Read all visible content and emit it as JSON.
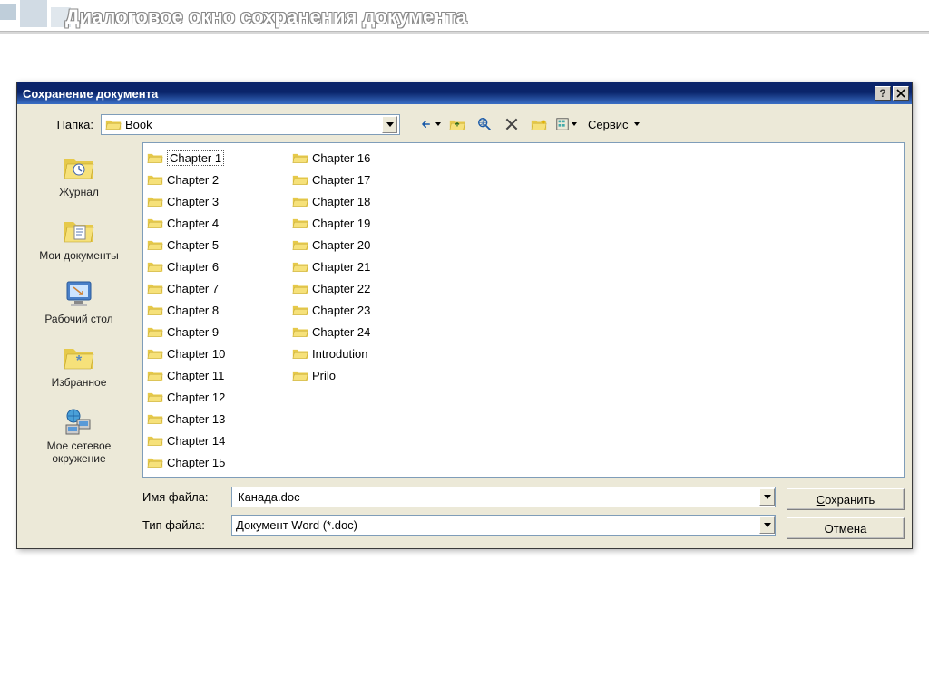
{
  "slide": {
    "title": "Диалоговое окно сохранения документа"
  },
  "dialog": {
    "title": "Сохранение документа",
    "folder_label": "Папка:",
    "current_folder": "Book",
    "tools_label": "Сервис",
    "filename_label": "Имя файла:",
    "filename_value": "Канада.doc",
    "filetype_label": "Тип файла:",
    "filetype_value": "Документ Word (*.doc)",
    "save_label": "Сохранить",
    "cancel_label": "Отмена"
  },
  "places": [
    {
      "label": "Журнал"
    },
    {
      "label": "Мои документы"
    },
    {
      "label": "Рабочий стол"
    },
    {
      "label": "Избранное"
    },
    {
      "label": "Мое сетевое окружение"
    }
  ],
  "files": [
    "Chapter 1",
    "Chapter 2",
    "Chapter 3",
    "Chapter 4",
    "Chapter 5",
    "Chapter 6",
    "Chapter 7",
    "Chapter 8",
    "Chapter 9",
    "Chapter 10",
    "Chapter 11",
    "Chapter 12",
    "Chapter 13",
    "Chapter 14",
    "Chapter 15",
    "Chapter 16",
    "Chapter 17",
    "Chapter 18",
    "Chapter 19",
    "Chapter 20",
    "Chapter 21",
    "Chapter 22",
    "Chapter 23",
    "Chapter 24",
    "Introdution",
    "Prilo"
  ]
}
